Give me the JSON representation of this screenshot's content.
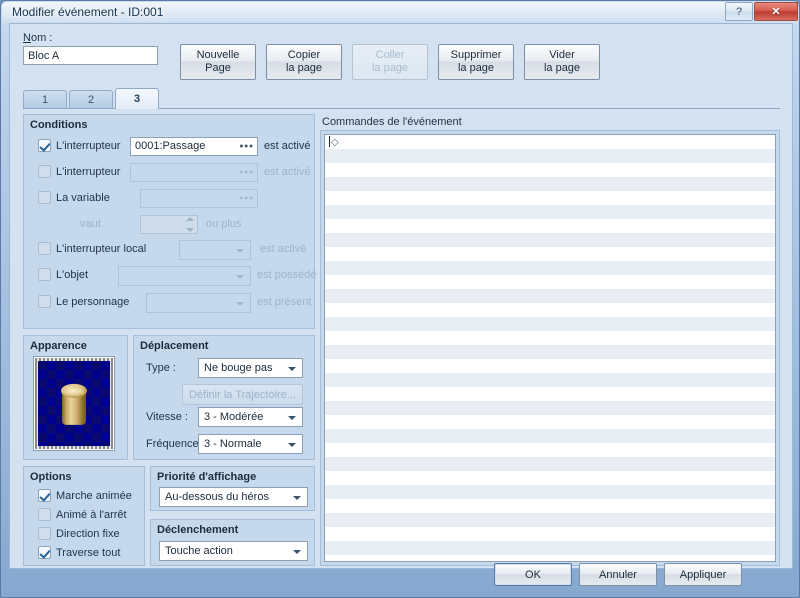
{
  "window": {
    "title": "Modifier événement - ID:001",
    "help_button": "?",
    "close_button": "✕"
  },
  "header": {
    "name_label": "Nom :",
    "name_value": "Bloc A",
    "buttons": [
      {
        "line1": "Nouvelle",
        "line2": "Page",
        "disabled": false
      },
      {
        "line1": "Copier",
        "line2": "la page",
        "disabled": false
      },
      {
        "line1": "Coller",
        "line2": "la page",
        "disabled": true
      },
      {
        "line1": "Supprimer",
        "line2": "la page",
        "disabled": false
      },
      {
        "line1": "Vider",
        "line2": "la page",
        "disabled": false
      }
    ]
  },
  "tabs": {
    "items": [
      {
        "label": "1",
        "active": false
      },
      {
        "label": "2",
        "active": false
      },
      {
        "label": "3",
        "active": true
      }
    ]
  },
  "conditions": {
    "title": "Conditions",
    "rows": [
      {
        "label": "L'interrupteur",
        "checked": true,
        "value": "0001:Passage",
        "suffix": "est activé"
      },
      {
        "label": "L'interrupteur",
        "checked": false,
        "value": "",
        "suffix": "est activé"
      },
      {
        "label": "La variable",
        "checked": false,
        "value": "",
        "suffix": ""
      },
      {
        "label": "vaut",
        "checked": null,
        "value": "",
        "suffix": "ou plus"
      },
      {
        "label": "L'interrupteur local",
        "checked": false,
        "value": "",
        "suffix": "est activé"
      },
      {
        "label": "L'objet",
        "checked": false,
        "value": "",
        "suffix": "est possédé"
      },
      {
        "label": "Le personnage",
        "checked": false,
        "value": "",
        "suffix": "est présent"
      }
    ]
  },
  "apparence": {
    "title": "Apparence"
  },
  "deplacement": {
    "title": "Déplacement",
    "type_label": "Type :",
    "type_value": "Ne bouge pas",
    "trajectory_button": "Définir la Trajectoire...",
    "vitesse_label": "Vitesse :",
    "vitesse_value": "3 - Modérée",
    "frequence_label": "Fréquence :",
    "frequence_value": "3 - Normale"
  },
  "options": {
    "title": "Options",
    "items": [
      {
        "label": "Marche animée",
        "checked": true
      },
      {
        "label": "Animé à l'arrêt",
        "checked": false
      },
      {
        "label": "Direction fixe",
        "checked": false
      },
      {
        "label": "Traverse tout",
        "checked": true
      }
    ]
  },
  "priorite": {
    "title": "Priorité d'affichage",
    "value": "Au-dessous du héros"
  },
  "declenchement": {
    "title": "Déclenchement",
    "value": "Touche action"
  },
  "commands": {
    "label": "Commandes de l'événement",
    "first_row": "◇",
    "row_count": 32
  },
  "footer": {
    "ok": "OK",
    "cancel": "Annuler",
    "apply": "Appliquer"
  },
  "colors": {
    "window_bg": "#b9cfe8",
    "client_bg": "#d3e1f1",
    "panel_bg": "#c6d8ec",
    "field_bg": "#ffffff",
    "text": "#1f3247",
    "disabled_text": "#9db3c9",
    "close_red": "#d2564a",
    "stripe": "#e8eef4"
  }
}
